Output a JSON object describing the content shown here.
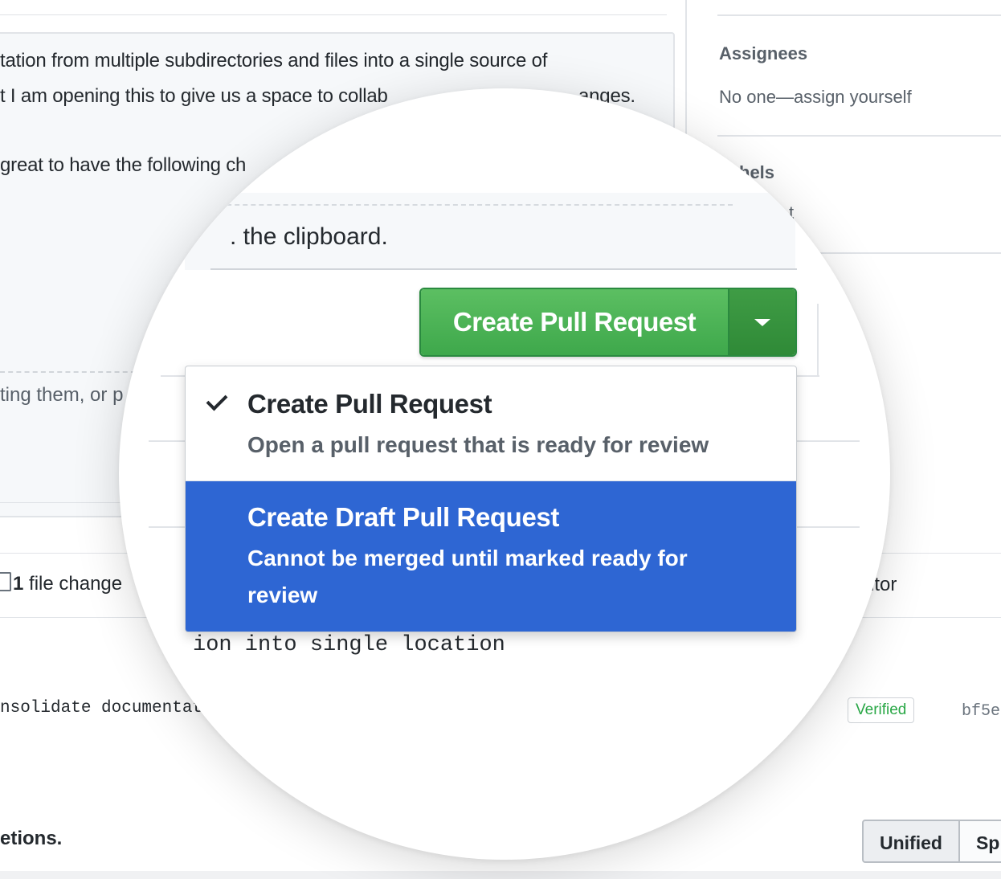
{
  "background": {
    "description_lines": [
      "tation from multiple subdirectories and files into a single source of",
      "t I am opening this to give us a space to collab",
      "great to have the following ch"
    ],
    "description_line2_tail": "anges.",
    "hint_text": "ting them, or p",
    "file_change_prefix": "1",
    "file_change_text": " file change",
    "commit_message": "nsolidate documentat",
    "deletions_text": "etions."
  },
  "sidebar": {
    "assignees_heading": "Assignees",
    "assignees_value": "No one—assign yourself",
    "labels_heading": "hels",
    "labels_value_fragment": "t",
    "contributor_fragment": "utor",
    "verified_badge": "Verified",
    "commit_sha": "bf5e",
    "view_toggle": {
      "unified": "Unified",
      "split": "Sp"
    }
  },
  "lens": {
    "editor_text": ". the clipboard.",
    "create_button_label": "Create Pull Request",
    "code_text": "ion into single location",
    "menu": {
      "items": [
        {
          "title": "Create Pull Request",
          "description": "Open a pull request that is ready for review",
          "checked": true
        },
        {
          "title": "Create Draft Pull Request",
          "description": "Cannot be merged until marked ready for review",
          "highlighted": true
        }
      ]
    }
  },
  "colors": {
    "primary_green": "#3ea84b",
    "menu_highlight": "#2e66d3",
    "verified_green": "#28a745"
  }
}
